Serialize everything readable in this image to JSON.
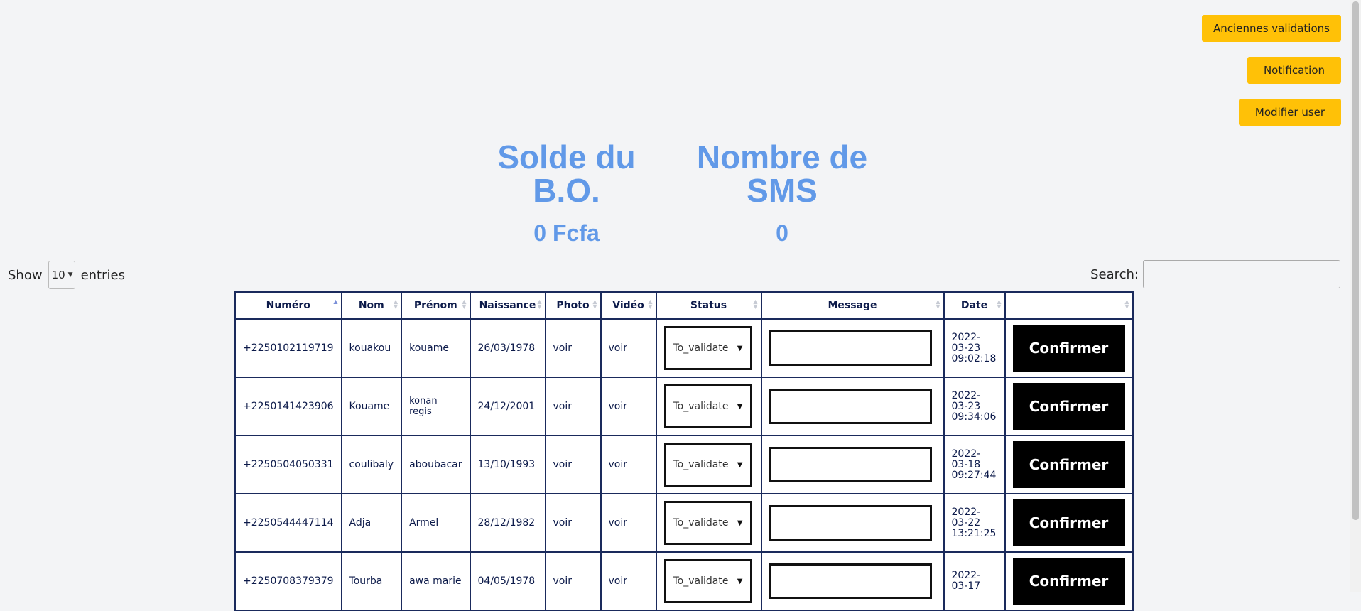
{
  "header_buttons": {
    "anciennes_validations": "Anciennes validations",
    "notification": "Notification",
    "modifier_user": "Modifier user"
  },
  "stats": {
    "solde": {
      "title_line1": "Solde du",
      "title_line2": "B.O.",
      "value": "0 Fcfa"
    },
    "sms": {
      "title_line1": "Nombre de",
      "title_line2": "SMS",
      "value": "0"
    }
  },
  "table_controls": {
    "show_label": "Show",
    "entries_value": "10",
    "entries_label": "entries",
    "search_label": "Search:",
    "search_value": ""
  },
  "table": {
    "columns": [
      "Numéro",
      "Nom",
      "Prénom",
      "Naissance",
      "Photo",
      "Vidéo",
      "Status",
      "Message",
      "Date",
      ""
    ],
    "sorted_column": "Numéro",
    "rows": [
      {
        "numero": "+2250102119719",
        "nom": "kouakou",
        "prenom": "kouame",
        "naissance": "26/03/1978",
        "photo": "voir",
        "video": "voir",
        "status": "To_validate",
        "message": "",
        "date_l1": "2022-",
        "date_l2": "03-23",
        "date_l3": "09:02:18",
        "action": "Confirmer"
      },
      {
        "numero": "+2250141423906",
        "nom": "Kouame",
        "prenom": "konan regis",
        "naissance": "24/12/2001",
        "photo": "voir",
        "video": "voir",
        "status": "To_validate",
        "message": "",
        "date_l1": "2022-",
        "date_l2": "03-23",
        "date_l3": "09:34:06",
        "action": "Confirmer"
      },
      {
        "numero": "+2250504050331",
        "nom": "coulibaly",
        "prenom": "aboubacar",
        "naissance": "13/10/1993",
        "photo": "voir",
        "video": "voir",
        "status": "To_validate",
        "message": "",
        "date_l1": "2022-",
        "date_l2": "03-18",
        "date_l3": "09:27:44",
        "action": "Confirmer"
      },
      {
        "numero": "+2250544447114",
        "nom": "Adja",
        "prenom": "Armel",
        "naissance": "28/12/1982",
        "photo": "voir",
        "video": "voir",
        "status": "To_validate",
        "message": "",
        "date_l1": "2022-",
        "date_l2": "03-22",
        "date_l3": "13:21:25",
        "action": "Confirmer"
      },
      {
        "numero": "+2250708379379",
        "nom": "Tourba",
        "prenom": "awa marie",
        "naissance": "04/05/1978",
        "photo": "voir",
        "video": "voir",
        "status": "To_validate",
        "message": "",
        "date_l1": "2022-",
        "date_l2": "03-17",
        "date_l3": "",
        "action": "Confirmer"
      }
    ]
  },
  "colors": {
    "accent_button": "#ffc107",
    "stat_text": "#6199e8",
    "confirm_button": "#000000",
    "table_border": "#1a2a5c"
  }
}
